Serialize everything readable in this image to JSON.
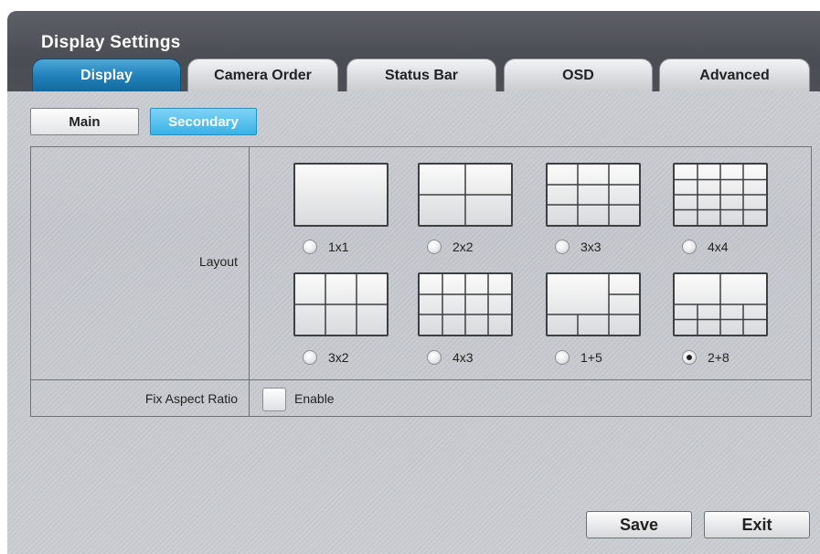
{
  "window": {
    "title": "Display Settings"
  },
  "tabs": [
    {
      "label": "Display",
      "active": true
    },
    {
      "label": "Camera Order",
      "active": false
    },
    {
      "label": "Status Bar",
      "active": false
    },
    {
      "label": "OSD",
      "active": false
    },
    {
      "label": "Advanced",
      "active": false
    }
  ],
  "subtabs": [
    {
      "label": "Main",
      "active": false
    },
    {
      "label": "Secondary",
      "active": true
    }
  ],
  "layout_row": {
    "label": "Layout",
    "options": [
      {
        "label": "1x1",
        "selected": false
      },
      {
        "label": "2x2",
        "selected": false
      },
      {
        "label": "3x3",
        "selected": false
      },
      {
        "label": "4x4",
        "selected": false
      },
      {
        "label": "3x2",
        "selected": false
      },
      {
        "label": "4x3",
        "selected": false
      },
      {
        "label": "1+5",
        "selected": false
      },
      {
        "label": "2+8",
        "selected": true
      }
    ]
  },
  "aspect_row": {
    "label": "Fix Aspect Ratio",
    "checkbox_label": "Enable",
    "checked": false
  },
  "footer": {
    "save_label": "Save",
    "exit_label": "Exit"
  },
  "colors": {
    "active_tab": "#1f7fb8",
    "active_subtab": "#39b2e6",
    "title_band": "#4c4f55"
  }
}
